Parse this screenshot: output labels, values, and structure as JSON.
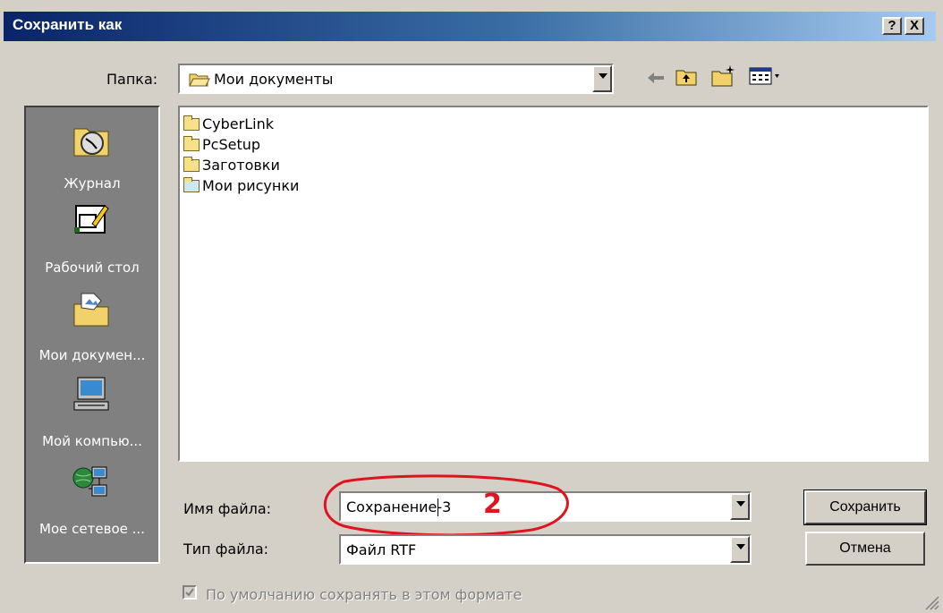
{
  "window": {
    "title": "Сохранить как",
    "help_button": "?",
    "close_button": "X"
  },
  "folder": {
    "label": "Папка:",
    "value": "Мои документы"
  },
  "places": [
    {
      "label": "Журнал",
      "icon": "history-icon"
    },
    {
      "label": "Рабочий стол",
      "icon": "desktop-icon"
    },
    {
      "label": "Мои докумен...",
      "icon": "my-documents-icon"
    },
    {
      "label": "Мой компью...",
      "icon": "my-computer-icon"
    },
    {
      "label": "Мое сетевое ...",
      "icon": "network-places-icon"
    }
  ],
  "files": [
    {
      "name": "CyberLink",
      "icon": "folder-icon"
    },
    {
      "name": "PcSetup",
      "icon": "folder-icon"
    },
    {
      "name": "Заготовки",
      "icon": "folder-icon"
    },
    {
      "name": "Мои рисунки",
      "icon": "pictures-folder-icon"
    }
  ],
  "filename": {
    "label": "Имя файла:",
    "value": "Сохранение-3",
    "annotation": "2"
  },
  "filetype": {
    "label": "Тип файла:",
    "value": "Файл RTF"
  },
  "buttons": {
    "save": "Сохранить",
    "cancel": "Отмена"
  },
  "default_format": {
    "label": "По умолчанию сохранять в этом формате",
    "checked": true
  },
  "colors": {
    "title_start": "#0a246a",
    "title_end": "#a6caf0",
    "annotation": "#e0141e"
  }
}
